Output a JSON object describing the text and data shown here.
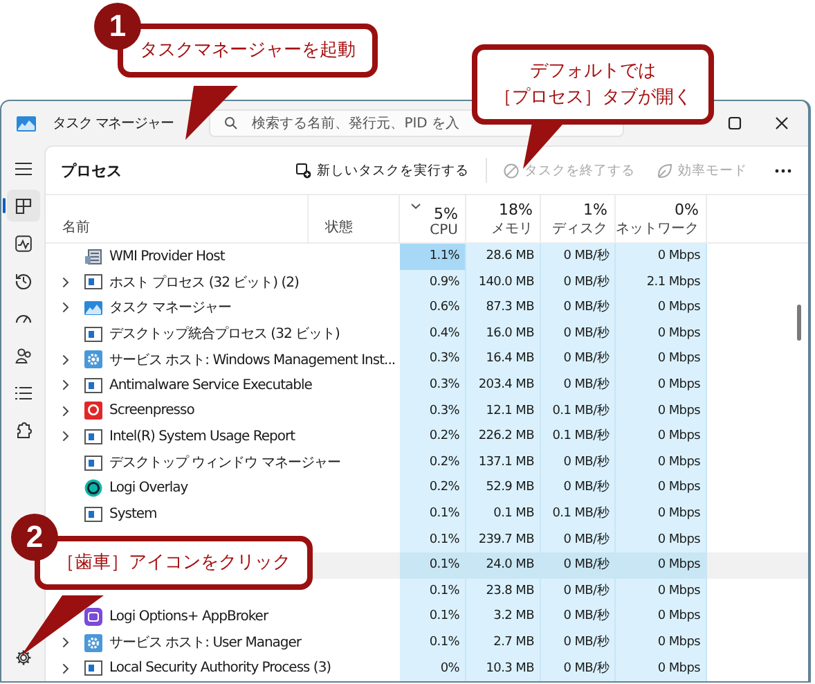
{
  "window": {
    "title": "タスク マネージャー",
    "search": {
      "placeholder": "検索する名前、発行元、PID を入"
    }
  },
  "sidebar": {
    "items": [
      {
        "kind": "menu",
        "selected": false
      },
      {
        "kind": "processes",
        "selected": true
      },
      {
        "kind": "performance",
        "selected": false
      },
      {
        "kind": "history",
        "selected": false
      },
      {
        "kind": "startup",
        "selected": false
      },
      {
        "kind": "users",
        "selected": false
      },
      {
        "kind": "details",
        "selected": false
      },
      {
        "kind": "services",
        "selected": false
      },
      {
        "kind": "settings",
        "selected": false
      }
    ]
  },
  "toolbar": {
    "title": "プロセス",
    "buttons": [
      {
        "kind": "run",
        "label": "新しいタスクを実行する",
        "disabled": false
      },
      {
        "kind": "end",
        "label": "タスクを終了する",
        "disabled": true
      },
      {
        "kind": "eco",
        "label": "効率モード",
        "disabled": true
      }
    ]
  },
  "columns": [
    {
      "label": "名前"
    },
    {
      "label": "状態"
    },
    {
      "percent": "5%",
      "label": "CPU",
      "sorted": true
    },
    {
      "percent": "18%",
      "label": "メモリ",
      "sorted": false
    },
    {
      "percent": "1%",
      "label": "ディスク",
      "sorted": false
    },
    {
      "percent": "0%",
      "label": "ネットワーク",
      "sorted": false
    }
  ],
  "rows": [
    {
      "name": "WMI Provider Host",
      "kind": "wmi",
      "expandable": false,
      "hovered": false,
      "hot": true,
      "cpu": "1.1%",
      "memory": "28.6 MB",
      "disk": "0 MB/秒",
      "network": "0 Mbps"
    },
    {
      "name": "ホスト プロセス (32 ビット) (2)",
      "kind": "window",
      "expandable": true,
      "hovered": false,
      "hot": false,
      "cpu": "0.9%",
      "memory": "140.0 MB",
      "disk": "0 MB/秒",
      "network": "2.1 Mbps"
    },
    {
      "name": "タスク マネージャー",
      "kind": "taskmgr",
      "expandable": true,
      "hovered": false,
      "hot": false,
      "cpu": "0.6%",
      "memory": "87.3 MB",
      "disk": "0 MB/秒",
      "network": "0 Mbps"
    },
    {
      "name": "デスクトップ統合プロセス (32 ビット)",
      "kind": "window",
      "expandable": false,
      "hovered": false,
      "hot": false,
      "cpu": "0.4%",
      "memory": "16.0 MB",
      "disk": "0 MB/秒",
      "network": "0 Mbps"
    },
    {
      "name": "サービス ホスト: Windows Management Inst...",
      "kind": "gear",
      "expandable": true,
      "hovered": false,
      "hot": false,
      "cpu": "0.3%",
      "memory": "16.4 MB",
      "disk": "0 MB/秒",
      "network": "0 Mbps"
    },
    {
      "name": "Antimalware Service Executable",
      "kind": "window",
      "expandable": true,
      "hovered": false,
      "hot": false,
      "cpu": "0.3%",
      "memory": "203.4 MB",
      "disk": "0 MB/秒",
      "network": "0 Mbps"
    },
    {
      "name": "Screenpresso",
      "kind": "screenpresso",
      "expandable": true,
      "hovered": false,
      "hot": false,
      "cpu": "0.3%",
      "memory": "12.1 MB",
      "disk": "0.1 MB/秒",
      "network": "0 Mbps"
    },
    {
      "name": "Intel(R) System Usage Report",
      "kind": "window",
      "expandable": true,
      "hovered": false,
      "hot": false,
      "cpu": "0.2%",
      "memory": "226.2 MB",
      "disk": "0.1 MB/秒",
      "network": "0 Mbps"
    },
    {
      "name": "デスクトップ ウィンドウ マネージャー",
      "kind": "window",
      "expandable": false,
      "hovered": false,
      "hot": false,
      "cpu": "0.2%",
      "memory": "137.1 MB",
      "disk": "0 MB/秒",
      "network": "0 Mbps"
    },
    {
      "name": "Logi Overlay",
      "kind": "logi-overlay",
      "expandable": false,
      "hovered": false,
      "hot": false,
      "cpu": "0.2%",
      "memory": "52.9 MB",
      "disk": "0 MB/秒",
      "network": "0 Mbps"
    },
    {
      "name": "System",
      "kind": "window",
      "expandable": false,
      "hovered": false,
      "hot": false,
      "cpu": "0.1%",
      "memory": "0.1 MB",
      "disk": "0.1 MB/秒",
      "network": "0 Mbps"
    },
    {
      "hovered": false,
      "hot": false,
      "cpu": "0.1%",
      "memory": "239.7 MB",
      "disk": "0 MB/秒",
      "network": "0 Mbps"
    },
    {
      "hovered": true,
      "hot": false,
      "cpu": "0.1%",
      "memory": "24.0 MB",
      "disk": "0 MB/秒",
      "network": "0 Mbps"
    },
    {
      "hovered": false,
      "hot": false,
      "cpu": "0.1%",
      "memory": "23.8 MB",
      "disk": "0 MB/秒",
      "network": "0 Mbps"
    },
    {
      "name": "Logi Options+ AppBroker",
      "kind": "logi-options",
      "hovered": false,
      "hot": false,
      "cpu": "0.1%",
      "memory": "3.2 MB",
      "disk": "0 MB/秒",
      "network": "0 Mbps"
    },
    {
      "name": "サービス ホスト: User Manager",
      "kind": "gear",
      "expandable": true,
      "hovered": false,
      "hot": false,
      "cpu": "0.1%",
      "memory": "2.7 MB",
      "disk": "0 MB/秒",
      "network": "0 Mbps"
    },
    {
      "name": "Local Security Authority Process (3)",
      "kind": "window",
      "expandable": true,
      "hovered": false,
      "hot": false,
      "cpu": "0%",
      "memory": "10.3 MB",
      "disk": "0 MB/秒",
      "network": "0 Mbps"
    }
  ],
  "callouts": [
    {
      "badge": "1",
      "lines": [
        "タスクマネージャーを起動"
      ]
    },
    {
      "lines": [
        "デフォルトでは",
        "［プロセス］タブが開く"
      ]
    },
    {
      "badge": "2",
      "lines": [
        "［歯車］アイコンをクリック"
      ]
    }
  ]
}
